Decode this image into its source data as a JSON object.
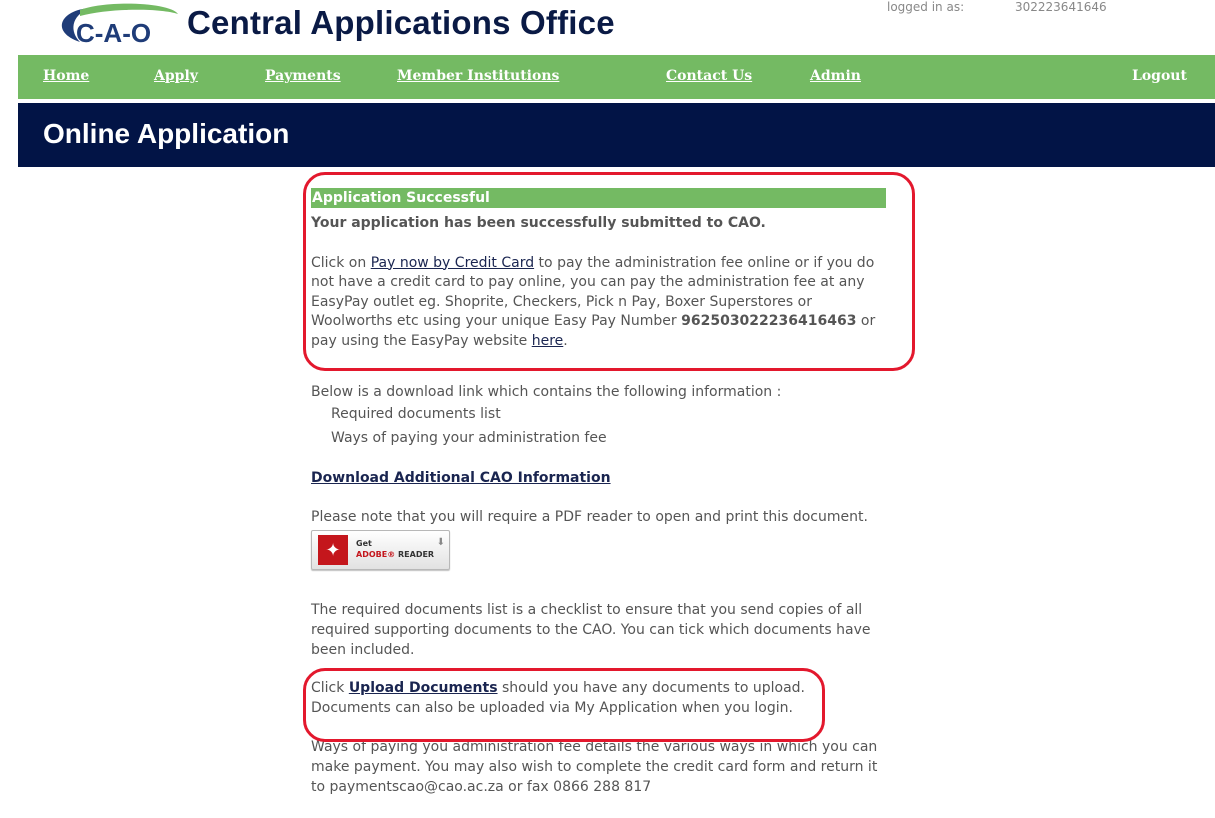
{
  "header": {
    "logo_text": "C-A-O",
    "site_title": "Central Applications Office",
    "login_label": "logged in as:",
    "login_id": "302223641646"
  },
  "nav": {
    "home": "Home",
    "apply": "Apply",
    "payments": "Payments",
    "institutions": "Member Institutions",
    "contact": "Contact Us",
    "admin": "Admin",
    "logout": "Logout"
  },
  "banner": {
    "title": "Online Application"
  },
  "success": {
    "heading": "Application Successful",
    "message": "Your application has been successfully submitted to CAO."
  },
  "payment": {
    "prefix": "Click on ",
    "pay_link": "Pay now by Credit Card",
    "middle": " to pay the administration fee online or if you do not have a credit card to pay online, you can pay the administration fee at any EasyPay outlet eg. Shoprite, Checkers, Pick n Pay, Boxer Superstores or Woolworths etc using your unique Easy Pay Number ",
    "easypay_number": "962503022236416463",
    "suffix": " or pay using the EasyPay website ",
    "here_link": "here",
    "end": "."
  },
  "download": {
    "intro": "Below is a download link which contains the following information :",
    "items": [
      "Required documents list",
      "Ways of paying your administration fee"
    ],
    "link": "Download Additional CAO Information",
    "pdf_note": "Please note that you will require a PDF reader to open and print this document.",
    "adobe_get": "Get",
    "adobe_brand": "ADOBE",
    "adobe_reader": "READER"
  },
  "checklist_text": "The required documents list is a checklist to ensure that you send copies of all required supporting documents to the CAO. You can tick which documents have been included.",
  "upload": {
    "prefix": "Click ",
    "link": "Upload Documents",
    "suffix": " should you have any documents to upload. Documents can also be uploaded via My Application when you login."
  },
  "fee_text": "Ways of paying you administration fee details the various ways in which you can make payment. You may also wish to complete the credit card form and return it to paymentscao@cao.ac.za or fax 0866 288 817",
  "colors": {
    "nav_green": "#74ba63",
    "banner_navy": "#021446",
    "highlight_red": "#e3182d"
  }
}
